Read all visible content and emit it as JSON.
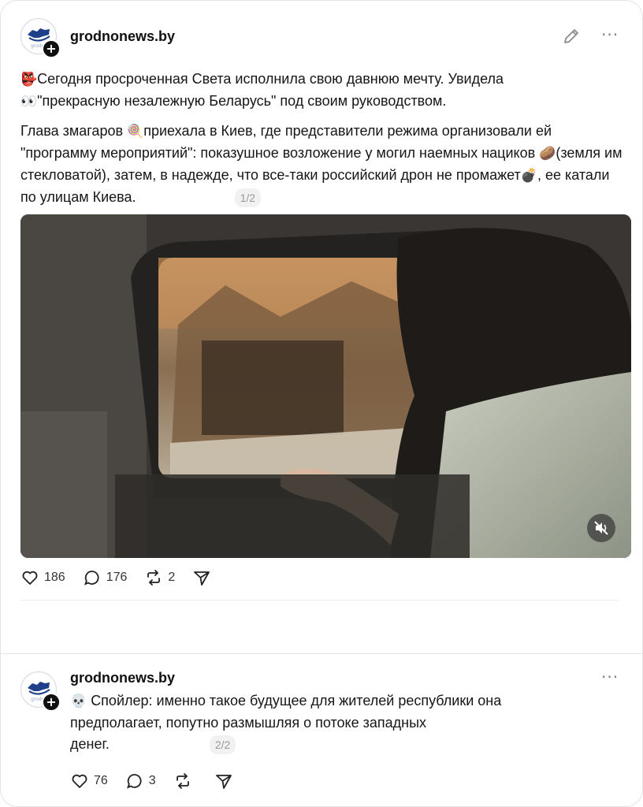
{
  "post1": {
    "username": "grodnonews.by",
    "text_p1": "Сегодня просроченная Света исполнила свою давнюю мечту. Увидела \"прекрасную незалежную Беларусь\" под своим руководством.",
    "p1_a": "Сегодня просроченная Света исполнила свою давнюю мечту. Увидела",
    "p1_b": "\"прекрасную незалежную Беларусь\" под своим руководством.",
    "p2_a": "Глава змагаров",
    "p2_b": "приехала в Киев, где представители режима организовали ей \"программу мероприятий\": показушное возложение у могил наемных нациков",
    "p2_c": "(земля им стекловатой), затем, в надежде, что все-таки российский дрон не промажет",
    "p2_d": ", ее катали по улицам Киева.",
    "pager": "1/2",
    "likes": "186",
    "comments": "176",
    "reposts": "2",
    "icons": [
      "pencil-icon",
      "more-icon",
      "heart-icon",
      "comment-icon",
      "repost-icon",
      "share-icon",
      "mute-icon"
    ]
  },
  "post2": {
    "username": "grodnonews.by",
    "text": "Спойлер: именно такое будущее для жителей республики она предполагает, попутно размышляя о потоке западных денег.",
    "line1": "Спойлер: именно такое будущее для жителей республики она",
    "line2": "предполагает, попутно размышляя о потоке западных",
    "line3": "денег.",
    "pager": "2/2",
    "likes": "76",
    "comments": "3"
  }
}
